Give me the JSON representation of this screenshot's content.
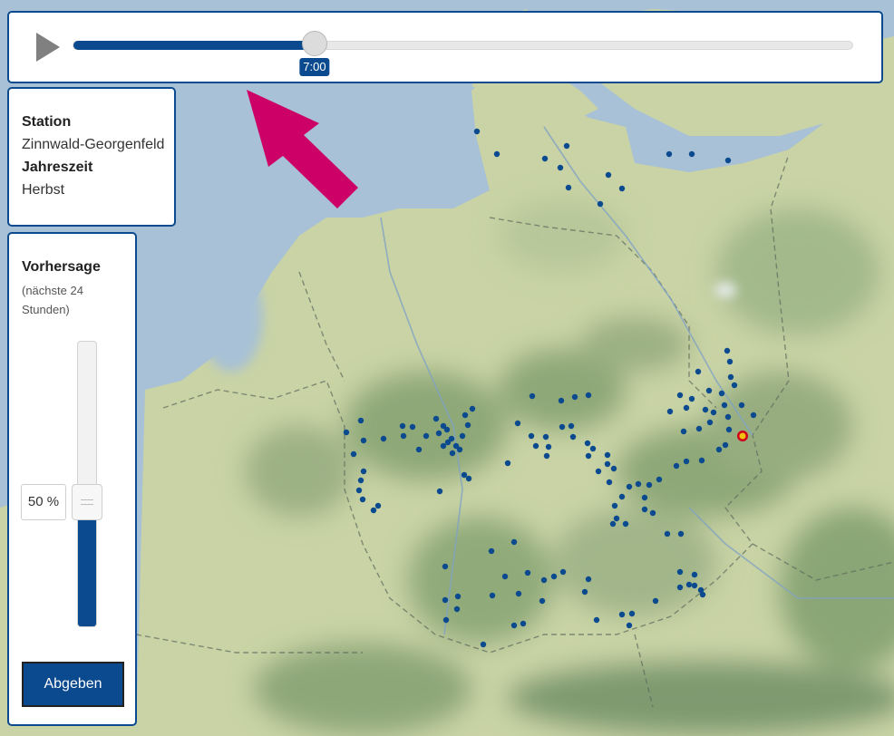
{
  "timeline": {
    "current_time": "7:00",
    "progress": 0.31
  },
  "station_info": {
    "station_label": "Station",
    "station_value": "Zinnwald-Georgenfeld",
    "season_label": "Jahreszeit",
    "season_value": "Herbst"
  },
  "forecast": {
    "title": "Vorhersage",
    "subtitle": "(nächste 24 Stunden)",
    "value_text": "50 %",
    "value": 0.5,
    "submit_label": "Abgeben"
  },
  "colors": {
    "accent": "#0b4a8e",
    "station_dot": "#0b4a8e",
    "selected_station": "#f1c40f",
    "selected_station_ring": "#d0021b",
    "arrow": "#cc0066",
    "sea": "#a8c1d6",
    "land": "#c8d3a8"
  },
  "icons": {
    "play": "play-icon",
    "hint_arrow": "arrow-up-left-icon"
  }
}
